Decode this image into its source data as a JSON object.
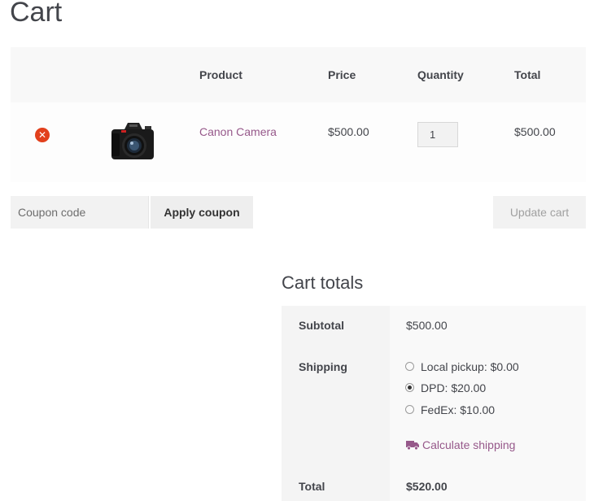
{
  "page": {
    "title": "Cart"
  },
  "cart_table": {
    "headers": {
      "product": "Product",
      "price": "Price",
      "quantity": "Quantity",
      "total": "Total"
    },
    "rows": [
      {
        "remove_icon": "close-circle-icon",
        "image": "canon-camera-thumbnail",
        "product": "Canon Camera",
        "price": "$500.00",
        "quantity": "1",
        "total": "$500.00"
      }
    ]
  },
  "actions": {
    "coupon_placeholder": "Coupon code",
    "apply_coupon_label": "Apply coupon",
    "update_cart_label": "Update cart"
  },
  "cart_totals": {
    "title": "Cart totals",
    "subtotal_label": "Subtotal",
    "subtotal_value": "$500.00",
    "shipping_label": "Shipping",
    "shipping_options": [
      {
        "label": "Local pickup: $0.00",
        "selected": false
      },
      {
        "label": "DPD: $20.00",
        "selected": true
      },
      {
        "label": "FedEx: $10.00",
        "selected": false
      }
    ],
    "calculate_shipping_label": "Calculate shipping",
    "calculate_shipping_icon": "truck-icon",
    "total_label": "Total",
    "total_value": "$520.00"
  },
  "colors": {
    "link": "#96588a",
    "remove": "#e2401c",
    "text": "#43454b"
  }
}
